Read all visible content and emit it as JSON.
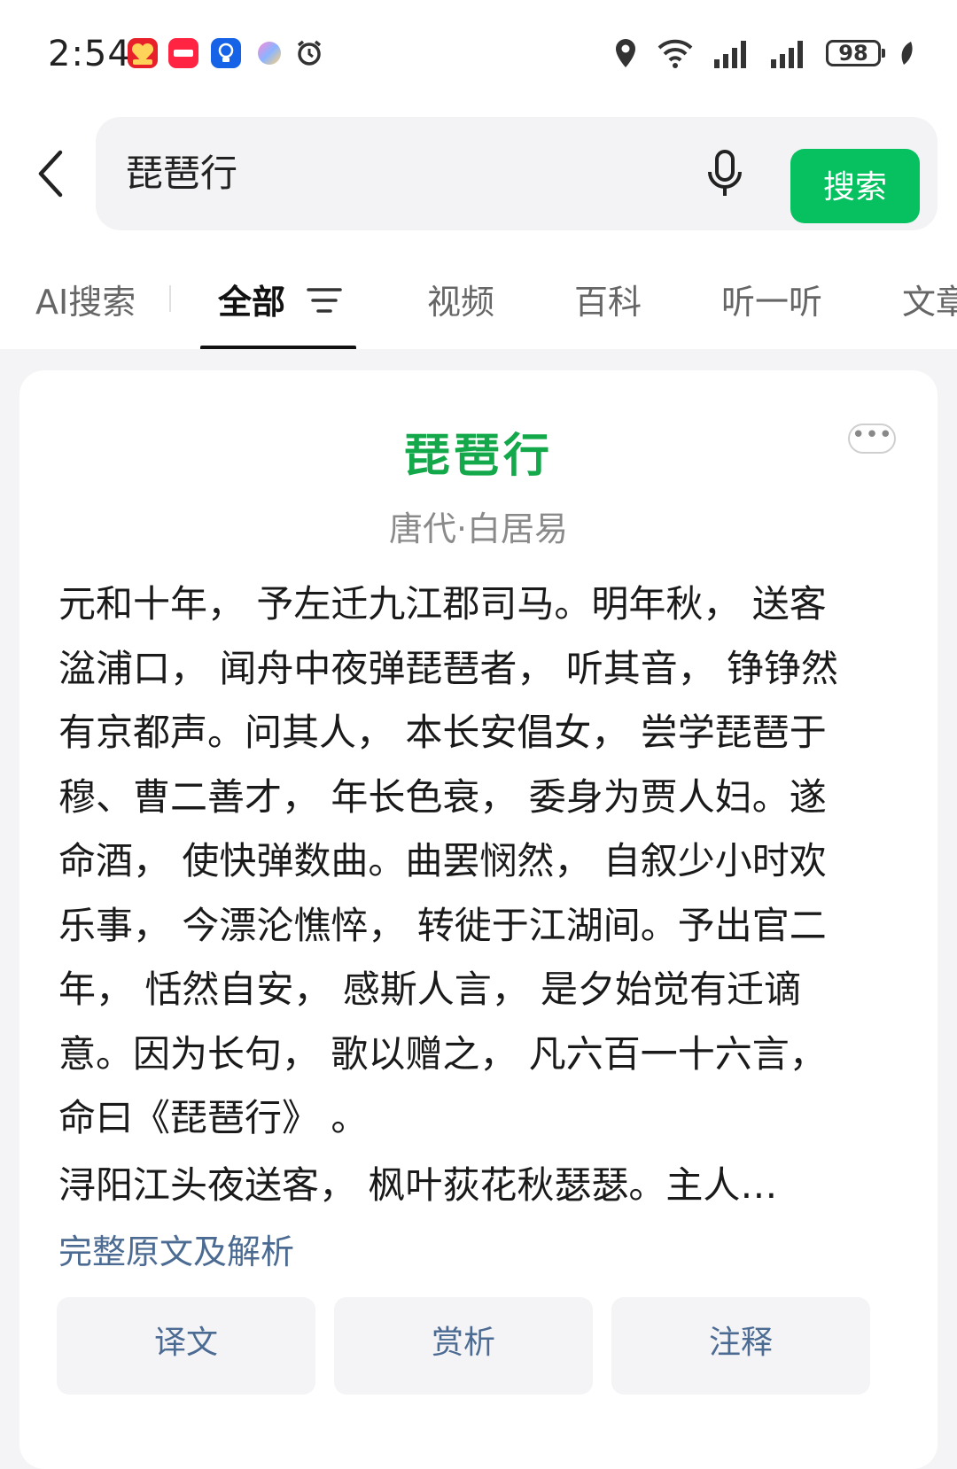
{
  "status_bar": {
    "time": "2:54",
    "app_icons": [
      "618-icon",
      "xiaohongshu-icon",
      "bulb-icon",
      "orb-icon",
      "alarm-icon"
    ],
    "battery": "98"
  },
  "search": {
    "query": "琵琶行",
    "button_label": "搜索"
  },
  "tabs": [
    {
      "label": "AI搜索"
    },
    {
      "label": "全部"
    },
    {
      "label": "视频"
    },
    {
      "label": "百科"
    },
    {
      "label": "听一听"
    },
    {
      "label": "文章"
    }
  ],
  "card": {
    "title": "琵琶行",
    "author": "唐代·白居易",
    "preface_lines": [
      "元和十年， 予左迁九江郡司马。明年秋， 送客",
      "湓浦口， 闻舟中夜弹琵琶者， 听其音， 铮铮然",
      "有京都声。问其人， 本长安倡女， 尝学琵琶于",
      "穆、曹二善才， 年长色衰， 委身为贾人妇。遂",
      "命酒， 使快弹数曲。曲罢悯然， 自叙少小时欢",
      "乐事， 今漂沦憔悴， 转徙于江湖间。予出官二",
      "年， 恬然自安， 感斯人言， 是夕始觉有迁谪",
      "意。因为长句， 歌以赠之， 凡六百一十六言，",
      "命曰《琵琶行》 。"
    ],
    "first_line": "浔阳江头夜送客， 枫叶荻花秋瑟瑟。主人…",
    "link": "完整原文及解析",
    "actions": [
      {
        "label": "译文"
      },
      {
        "label": "赏析"
      },
      {
        "label": "注释"
      }
    ]
  },
  "colors": {
    "accent": "#07c160",
    "title": "#13a94a",
    "link": "#4c6b92"
  }
}
